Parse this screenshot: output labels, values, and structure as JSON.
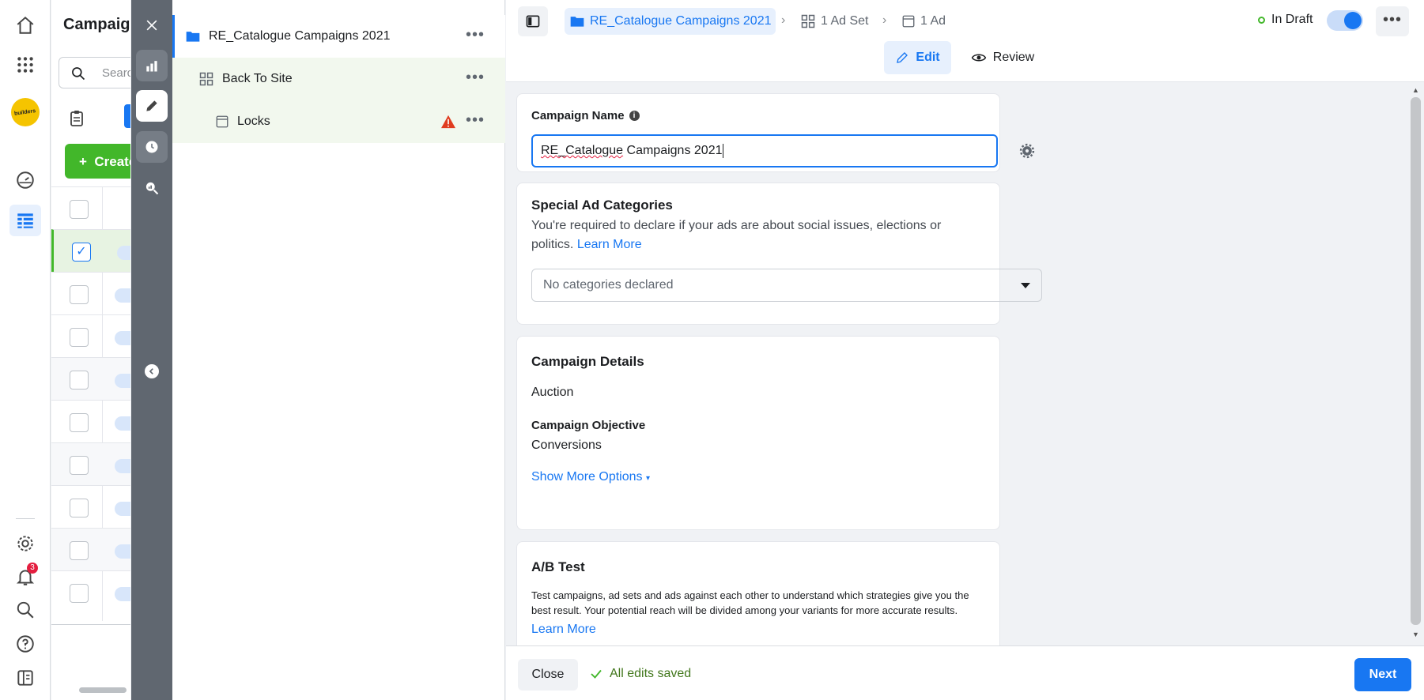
{
  "campaigns_panel": {
    "title": "Campaigns",
    "search_placeholder": "Search",
    "create_label": "Create",
    "rows": [
      {
        "checked": false
      },
      {
        "checked": true
      },
      {
        "checked": false
      },
      {
        "checked": false
      },
      {
        "checked": false
      },
      {
        "checked": false
      },
      {
        "checked": false
      },
      {
        "checked": false
      },
      {
        "checked": false
      }
    ]
  },
  "rail": {
    "notifications_count": "3",
    "logo_text": "builders"
  },
  "tree": {
    "campaign": "RE_Catalogue Campaigns 2021",
    "ad_set": "Back To Site",
    "ad": "Locks"
  },
  "topbar": {
    "breadcrumb_campaign": "RE_Catalogue Campaigns 2021",
    "breadcrumb_adset": "1 Ad Set",
    "breadcrumb_ad": "1 Ad",
    "status": "In Draft",
    "edit_label": "Edit",
    "review_label": "Review"
  },
  "campaign_name": {
    "label": "Campaign Name",
    "value_prefix": "RE_Catalogue",
    "value_rest": " Campaigns 2021"
  },
  "special_ad": {
    "title": "Special Ad Categories",
    "description": "You're required to declare if your ads are about social issues, elections or politics.",
    "learn_more": "Learn More",
    "select_value": "No categories declared"
  },
  "details": {
    "title": "Campaign Details",
    "buying_type": "Auction",
    "objective_label": "Campaign Objective",
    "objective_value": "Conversions",
    "show_more": "Show More Options"
  },
  "ab_test": {
    "title": "A/B Test",
    "description": "Test campaigns, ad sets and ads against each other to understand which strategies give you the best result. Your potential reach will be divided among your variants for more accurate results.",
    "learn_more": "Learn More"
  },
  "footer": {
    "close_label": "Close",
    "saved_label": "All edits saved",
    "next_label": "Next"
  },
  "colors": {
    "accent": "#1877f2",
    "success": "#42b72a",
    "warning": "#e03c1f"
  }
}
